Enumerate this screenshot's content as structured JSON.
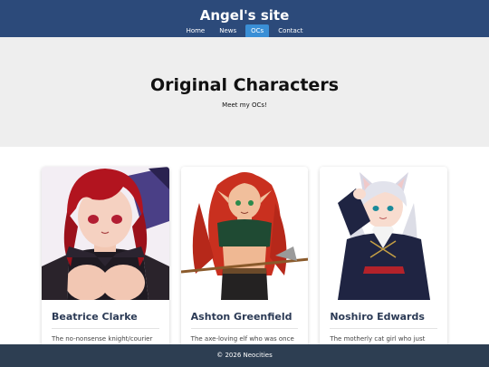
{
  "header": {
    "site_title": "Angel's site",
    "nav": [
      {
        "label": "Home",
        "active": false
      },
      {
        "label": "News",
        "active": false
      },
      {
        "label": "OCs",
        "active": true
      },
      {
        "label": "Contact",
        "active": false
      }
    ]
  },
  "hero": {
    "title": "Original Characters",
    "subtitle": "Meet my OCs!"
  },
  "cards": [
    {
      "name": "Beatrice Clarke",
      "description": "The no-nonsense knight/courier"
    },
    {
      "name": "Ashton Greenfield",
      "description": "The axe-loving elf who was once"
    },
    {
      "name": "Noshiro Edwards",
      "description": "The motherly cat girl who just"
    }
  ],
  "footer": {
    "text": "© 2026 Neocities"
  },
  "colors": {
    "header_bg": "#2c4a7a",
    "nav_active": "#3a8fd6",
    "hero_bg": "#eeeeee",
    "footer_bg": "#2d3e52",
    "card_name": "#2b3a55"
  }
}
